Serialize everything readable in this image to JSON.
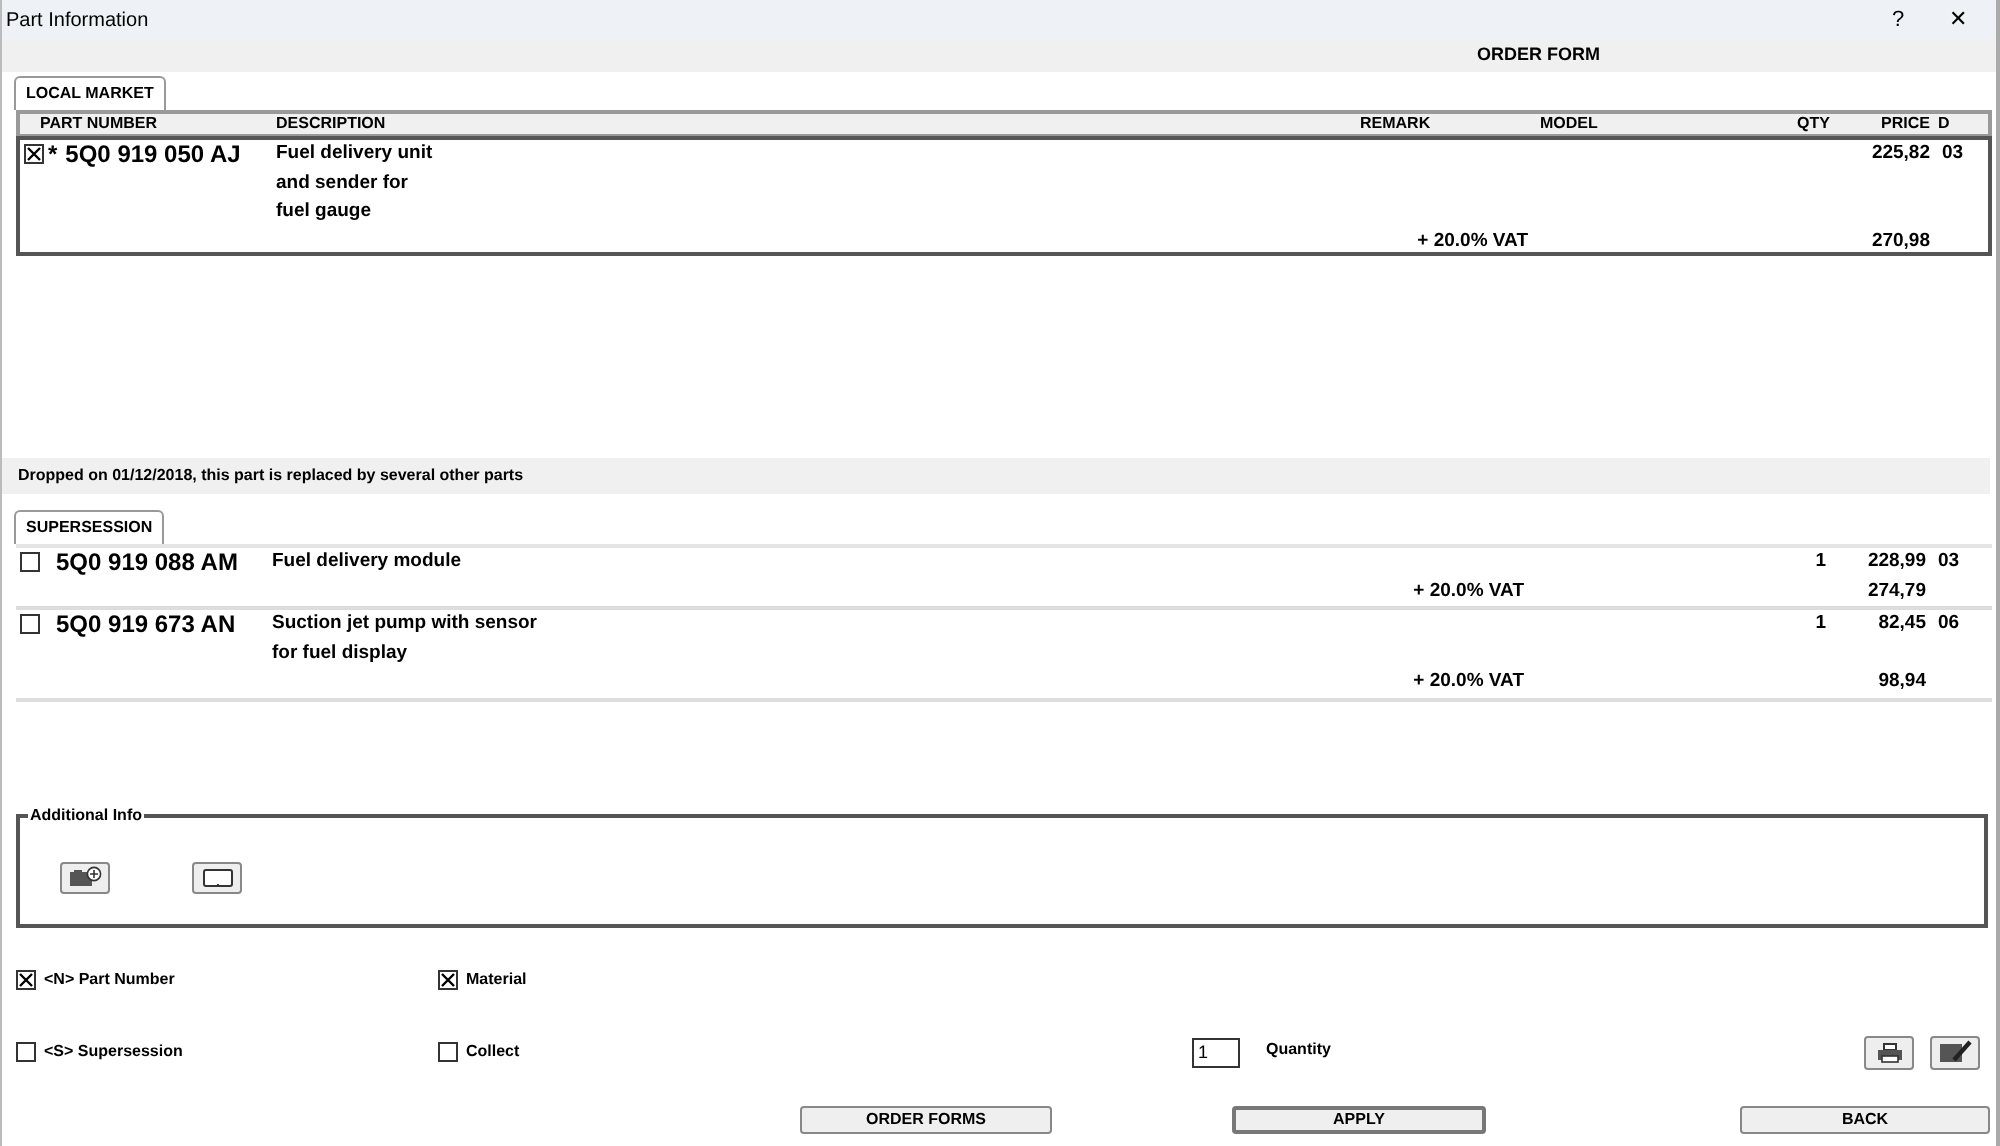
{
  "window": {
    "title": "Part Information",
    "help_button": "?",
    "close_button": "✕"
  },
  "header": "ORDER FORM",
  "local_market": {
    "tab": {
      "label": "LOCAL MARKET",
      "selected": true
    },
    "columns": [
      "PART NUMBER",
      "DESCRIPTION",
      "REMARK",
      "MODEL",
      "QTY",
      "PRICE",
      "D"
    ],
    "rows": [
      {
        "checked": true,
        "flag": "*",
        "part_number": "5Q0 919 050 AJ",
        "description_lines": [
          "Fuel delivery unit",
          "and sender for",
          "fuel gauge"
        ],
        "price": "225,82",
        "d": "03",
        "vat_label": "+ 20.0% VAT",
        "vat_price": "270,98"
      }
    ]
  },
  "notice": "Dropped on 01/12/2018, this part is replaced by several other parts",
  "supersession": {
    "tab": {
      "label": "SUPERSESSION",
      "selected": true
    },
    "rows": [
      {
        "checked": false,
        "part_number": "5Q0 919 088 AM",
        "description_lines": [
          "Fuel delivery module"
        ],
        "qty": "1",
        "price": "228,99",
        "d": "03",
        "vat_label": "+ 20.0% VAT",
        "vat_price": "274,79"
      },
      {
        "checked": false,
        "part_number": "5Q0 919 673 AN",
        "description_lines": [
          "Suction jet pump with sensor",
          "for fuel display"
        ],
        "qty": "1",
        "price": "82,45",
        "d": "06",
        "vat_label": "+ 20.0% VAT",
        "vat_price": "98,94"
      }
    ]
  },
  "additional_info": {
    "title": "Additional Info"
  },
  "options": [
    {
      "label": "<N> Part Number",
      "checked": true
    },
    {
      "label": "Material",
      "checked": true
    },
    {
      "label": "<S> Supersession",
      "checked": false
    },
    {
      "label": "Collect",
      "checked": false
    }
  ],
  "quantity": {
    "value": "1",
    "label": "Quantity"
  },
  "buttons": [
    {
      "label": "ORDER FORMS",
      "default": false
    },
    {
      "label": "APPLY",
      "default": true
    },
    {
      "label": "BACK",
      "default": false
    }
  ]
}
